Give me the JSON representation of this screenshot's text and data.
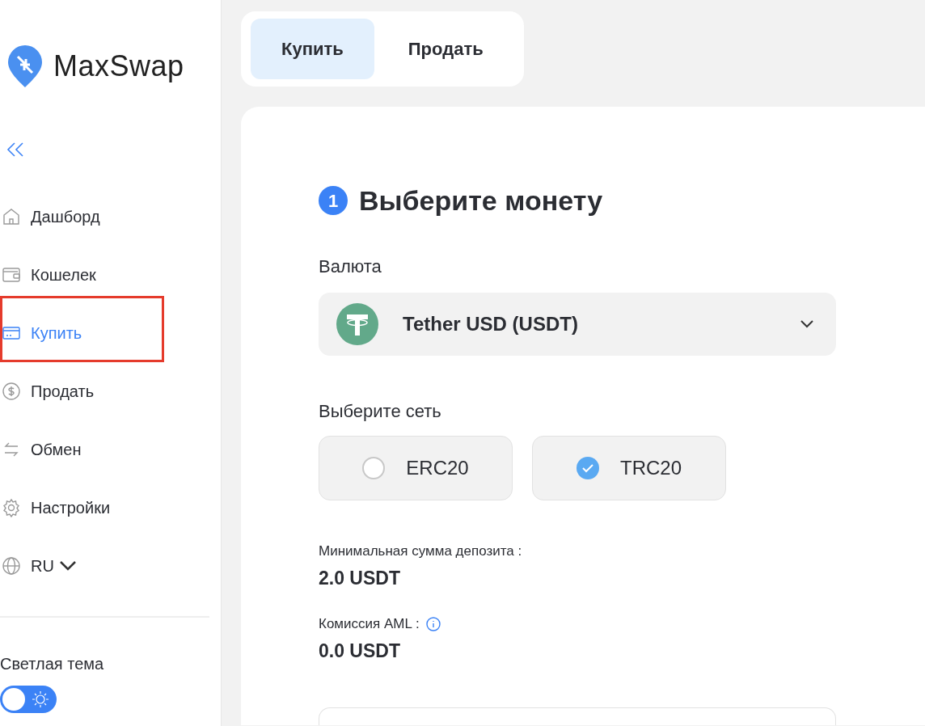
{
  "brand": {
    "name": "MaxSwap"
  },
  "sidebar": {
    "items": [
      {
        "label": "Дашборд",
        "selected": false,
        "annotated": false
      },
      {
        "label": "Кошелек",
        "selected": false,
        "annotated": false
      },
      {
        "label": "Купить",
        "selected": true,
        "annotated": true
      },
      {
        "label": "Продать",
        "selected": false,
        "annotated": false
      },
      {
        "label": "Обмен",
        "selected": false,
        "annotated": false
      },
      {
        "label": "Настройки",
        "selected": false,
        "annotated": false
      }
    ],
    "language": "RU",
    "theme_label": "Светлая тема",
    "theme_toggle": {
      "on": true
    }
  },
  "tabs": [
    {
      "label": "Купить",
      "selected": true
    },
    {
      "label": "Продать",
      "selected": false
    }
  ],
  "step": {
    "number": "1",
    "title": "Выберите монету"
  },
  "currency": {
    "label": "Валюта",
    "value": "Tether USD (USDT)"
  },
  "network": {
    "label": "Выберите сеть",
    "options": [
      {
        "label": "ERC20",
        "selected": false
      },
      {
        "label": "TRC20",
        "selected": true
      }
    ]
  },
  "info": [
    {
      "label": "Минимальная сумма депозита :",
      "value": "2.0 USDT",
      "info_icon": false
    },
    {
      "label": "Комиссия AML :",
      "value": "0.0 USDT",
      "info_icon": true
    }
  ]
}
